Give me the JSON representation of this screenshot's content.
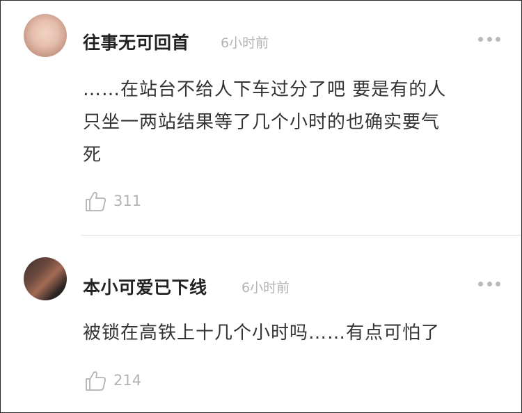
{
  "comments": [
    {
      "username": "往事无可回首",
      "time": "6小时前",
      "content_lines": [
        "……在站台不给人下车过分了吧 要是有的人",
        "只坐一两站结果等了几个小时的也确实要气",
        "死"
      ],
      "likes": "311",
      "avatar_icon": "user-avatar-icon"
    },
    {
      "username": "本小可爱已下线",
      "time": "6小时前",
      "content_lines": [
        "被锁在高铁上十几个小时吗……有点可怕了"
      ],
      "likes": "214",
      "avatar_icon": "user-avatar-icon"
    }
  ],
  "icons": {
    "like": "thumbs-up-icon",
    "more": "more-options-icon"
  },
  "colors": {
    "username": "#222222",
    "content": "#333333",
    "meta": "#b3b3b3"
  }
}
